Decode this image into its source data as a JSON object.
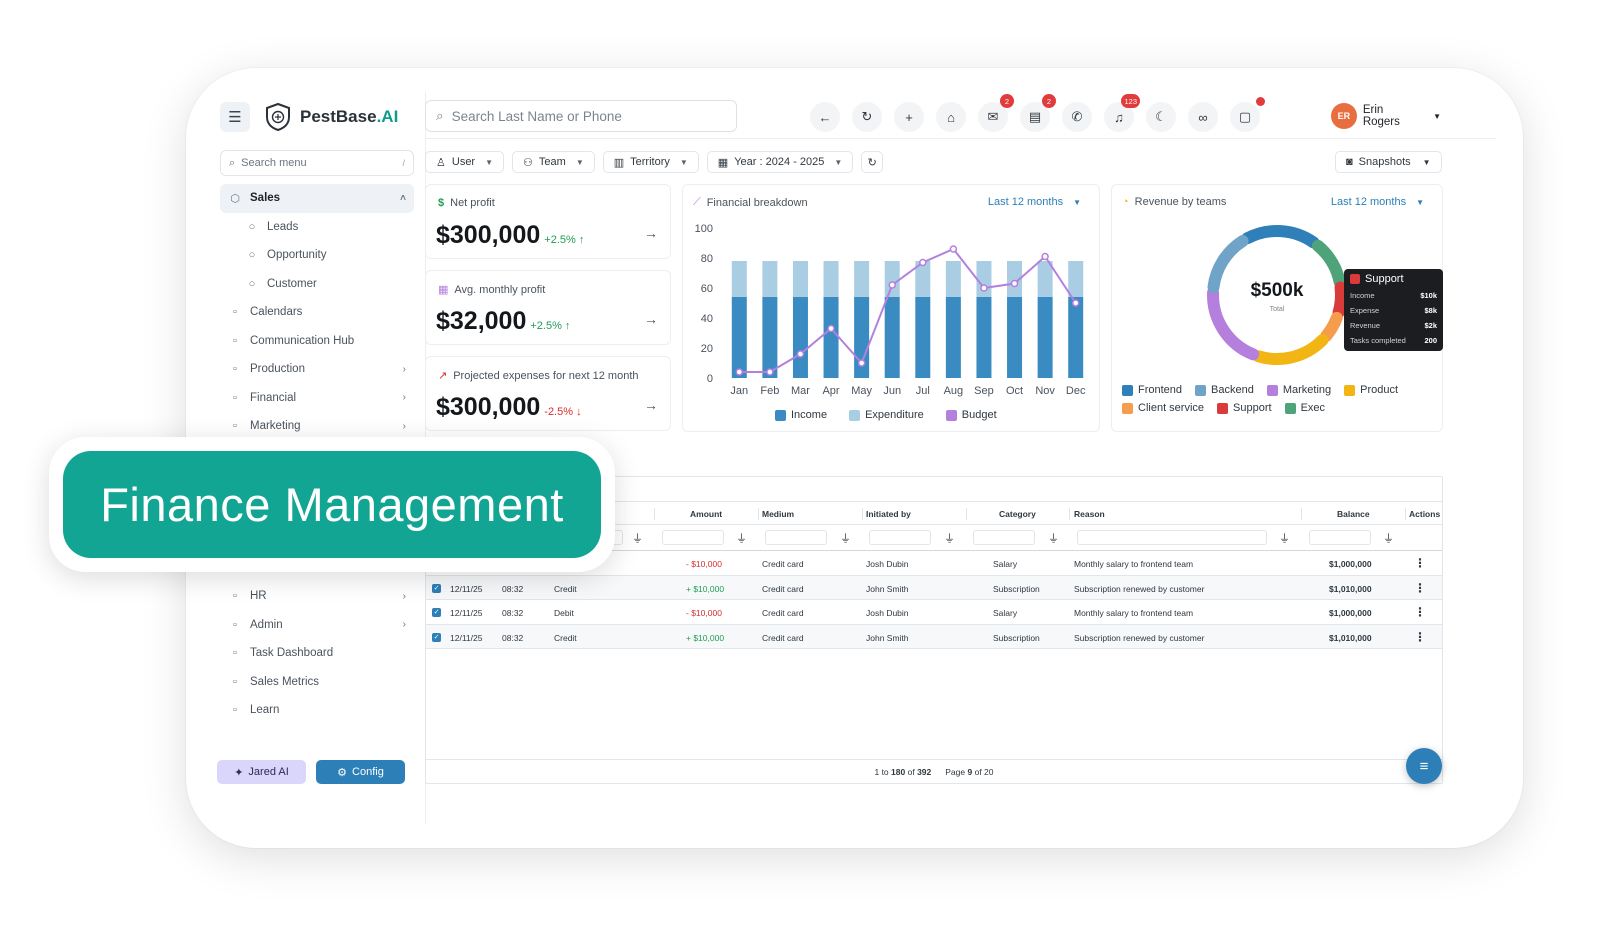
{
  "brand": {
    "name_main": "PestBase",
    "name_suffix": ".AI"
  },
  "sidebar": {
    "search_placeholder": "Search menu",
    "search_kbd": "/",
    "items": [
      {
        "label": "Sales",
        "icon": "sales-icon",
        "active": true,
        "chevron": "up"
      },
      {
        "label": "Leads",
        "icon": "leads-icon",
        "sub": true
      },
      {
        "label": "Opportunity",
        "icon": "opportunity-icon",
        "sub": true
      },
      {
        "label": "Customer",
        "icon": "customer-icon",
        "sub": true
      },
      {
        "label": "Calendars",
        "icon": "calendar-icon"
      },
      {
        "label": "Communication Hub",
        "icon": "chat-icon"
      },
      {
        "label": "Production",
        "icon": "production-icon",
        "chevron": "right"
      },
      {
        "label": "Financial",
        "icon": "financial-icon",
        "chevron": "right"
      },
      {
        "label": "Marketing",
        "icon": "marketing-icon",
        "chevron": "right"
      }
    ],
    "lower_items": [
      {
        "label": "HR",
        "icon": "hr-icon",
        "chevron": "right"
      },
      {
        "label": "Admin",
        "icon": "admin-icon",
        "chevron": "right"
      },
      {
        "label": "Task Dashboard",
        "icon": "task-icon"
      },
      {
        "label": "Sales Metrics",
        "icon": "metrics-icon"
      },
      {
        "label": "Learn",
        "icon": "learn-icon"
      }
    ],
    "jared_label": "Jared AI",
    "config_label": "Config"
  },
  "topbar": {
    "search_placeholder": "Search Last Name or Phone",
    "mail_badge": "2",
    "chat_badge": "2",
    "notif_badge": "123",
    "user_name": "Erin Rogers"
  },
  "filters": {
    "user": "User",
    "team": "Team",
    "territory": "Territory",
    "year": "Year : 2024 - 2025",
    "snapshots": "Snapshots"
  },
  "kpis": [
    {
      "title": "Net profit",
      "value": "$300,000",
      "delta": "+2.5%",
      "trend": "up"
    },
    {
      "title": "Avg. monthly profit",
      "value": "$32,000",
      "delta": "+2.5%",
      "trend": "up"
    },
    {
      "title": "Projected expenses for next 12 month",
      "value": "$300,000",
      "delta": "-2.5%",
      "trend": "down"
    }
  ],
  "financial_breakdown": {
    "title": "Financial breakdown",
    "range": "Last 12 months"
  },
  "chart_data": [
    {
      "type": "bar",
      "title": "Financial breakdown",
      "categories": [
        "Jan",
        "Feb",
        "Mar",
        "Apr",
        "May",
        "Jun",
        "Jul",
        "Aug",
        "Sep",
        "Oct",
        "Nov",
        "Dec"
      ],
      "ylim": [
        0,
        100
      ],
      "yticks": [
        "100",
        "80",
        "60",
        "40",
        "20",
        "0"
      ],
      "stacked": true,
      "series": [
        {
          "name": "Income",
          "values": [
            54,
            54,
            54,
            54,
            54,
            54,
            54,
            54,
            54,
            54,
            54,
            54
          ],
          "color": "#3a8bc1"
        },
        {
          "name": "Expenditure",
          "values": [
            24,
            24,
            24,
            24,
            24,
            24,
            24,
            24,
            24,
            24,
            24,
            24
          ],
          "color": "#a9cde3"
        },
        {
          "name": "Budget",
          "values": [
            4,
            4,
            16,
            33,
            10,
            62,
            77,
            86,
            60,
            63,
            81,
            50
          ],
          "color": "#b57fdd",
          "type": "line"
        }
      ],
      "legend_position": "bottom"
    },
    {
      "type": "pie",
      "title": "Revenue by teams",
      "center_value": "$500k",
      "center_label": "Total",
      "labels": [
        "Frontend",
        "Backend",
        "Marketing",
        "Product",
        "Client service",
        "Support",
        "Exec"
      ],
      "values": [
        17,
        14,
        19,
        17,
        6,
        7,
        11
      ],
      "colors": [
        "#2f7fb8",
        "#6fa3c7",
        "#b57fdd",
        "#f2b614",
        "#f59d4c",
        "#d93a3a",
        "#4fa37a"
      ],
      "legend_position": "bottom"
    }
  ],
  "revenue_by_teams": {
    "title": "Revenue by teams",
    "range": "Last 12 months",
    "tooltip": {
      "title": "Support",
      "rows": [
        {
          "label": "Income",
          "value": "$10k"
        },
        {
          "label": "Expense",
          "value": "$8k"
        },
        {
          "label": "Revenue",
          "value": "$2k"
        },
        {
          "label": "Tasks completed",
          "value": "200"
        }
      ]
    }
  },
  "table": {
    "headers": {
      "amount": "Amount",
      "medium": "Medium",
      "initiated_by": "Initiated by",
      "category": "Category",
      "reason": "Reason",
      "balance": "Balance",
      "actions": "Actions"
    },
    "rows": [
      {
        "checked": false,
        "date": "",
        "time": "",
        "type": "",
        "amount": "- $10,000",
        "sign": "neg",
        "medium": "Credit card",
        "initiated_by": "Josh Dubin",
        "category": "Salary",
        "reason": "Monthly salary to frontend team",
        "balance": "$1,000,000"
      },
      {
        "checked": true,
        "date": "12/11/25",
        "time": "08:32",
        "type": "Credit",
        "amount": "+ $10,000",
        "sign": "pos",
        "medium": "Credit card",
        "initiated_by": "John Smith",
        "category": "Subscription",
        "reason": "Subscription renewed by customer",
        "balance": "$1,010,000"
      },
      {
        "checked": true,
        "date": "12/11/25",
        "time": "08:32",
        "type": "Debit",
        "amount": "- $10,000",
        "sign": "neg",
        "medium": "Credit card",
        "initiated_by": "Josh Dubin",
        "category": "Salary",
        "reason": "Monthly salary to frontend team",
        "balance": "$1,000,000"
      },
      {
        "checked": true,
        "date": "12/11/25",
        "time": "08:32",
        "type": "Credit",
        "amount": "+ $10,000",
        "sign": "pos",
        "medium": "Credit card",
        "initiated_by": "John Smith",
        "category": "Subscription",
        "reason": "Subscription renewed by customer",
        "balance": "$1,010,000"
      }
    ],
    "pager": {
      "range_prefix": "1 to",
      "range_end": "180",
      "range_of": "of",
      "total": "392",
      "page_prefix": "Page",
      "page": "9",
      "page_of": "of 20"
    }
  },
  "banner": {
    "label": "Finance Management"
  },
  "colors": {
    "accent": "#12a594",
    "primary": "#2d7fb8",
    "positive": "#1f9d55",
    "negative": "#d92d2d"
  }
}
